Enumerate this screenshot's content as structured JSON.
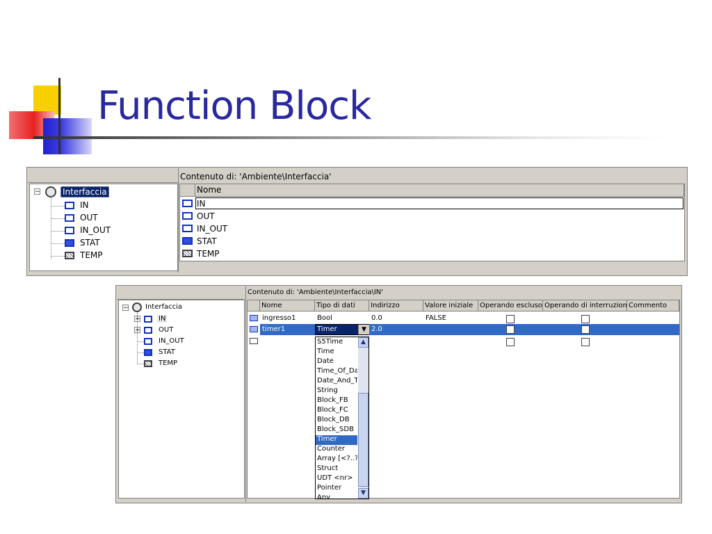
{
  "slide": {
    "title": "Function Block"
  },
  "window1": {
    "header": "Contenuto di: 'Ambiente\\Interfaccia'",
    "tree": {
      "root": "Interfaccia",
      "items": [
        "IN",
        "OUT",
        "IN_OUT",
        "STAT",
        "TEMP"
      ]
    },
    "column": "Nome",
    "rows": [
      "IN",
      "OUT",
      "IN_OUT",
      "STAT",
      "TEMP"
    ]
  },
  "window2": {
    "header": "Contenuto di: 'Ambiente\\Interfaccia\\IN'",
    "tree": {
      "root": "Interfaccia",
      "items": [
        "IN",
        "OUT",
        "IN_OUT",
        "STAT",
        "TEMP"
      ]
    },
    "columns": [
      "Nome",
      "Tipo di dati",
      "Indirizzo",
      "Valore iniziale",
      "Operando escluso",
      "Operando di interruzione",
      "Commento"
    ],
    "rows": [
      {
        "name": "ingresso1",
        "type": "Bool",
        "address": "0.0",
        "initial": "FALSE"
      },
      {
        "name": "timer1",
        "type": "Timer",
        "address": "2.0",
        "initial": ""
      },
      {
        "name": "",
        "type": "",
        "address": "",
        "initial": ""
      }
    ],
    "dropdown": {
      "options": [
        "S5Time",
        "Time",
        "Date",
        "Time_Of_Da",
        "Date_And_T",
        "String",
        "Block_FB",
        "Block_FC",
        "Block_DB",
        "Block_SDB",
        "Timer",
        "Counter",
        "Array [<?..?:",
        "Struct",
        "UDT <nr>",
        "Pointer",
        "Any"
      ],
      "selected": "Timer"
    }
  },
  "colors": {
    "title": "#2828a0",
    "selection": "#0a246a",
    "row_highlight": "#316ac5",
    "window_bg": "#d4d0c8"
  }
}
